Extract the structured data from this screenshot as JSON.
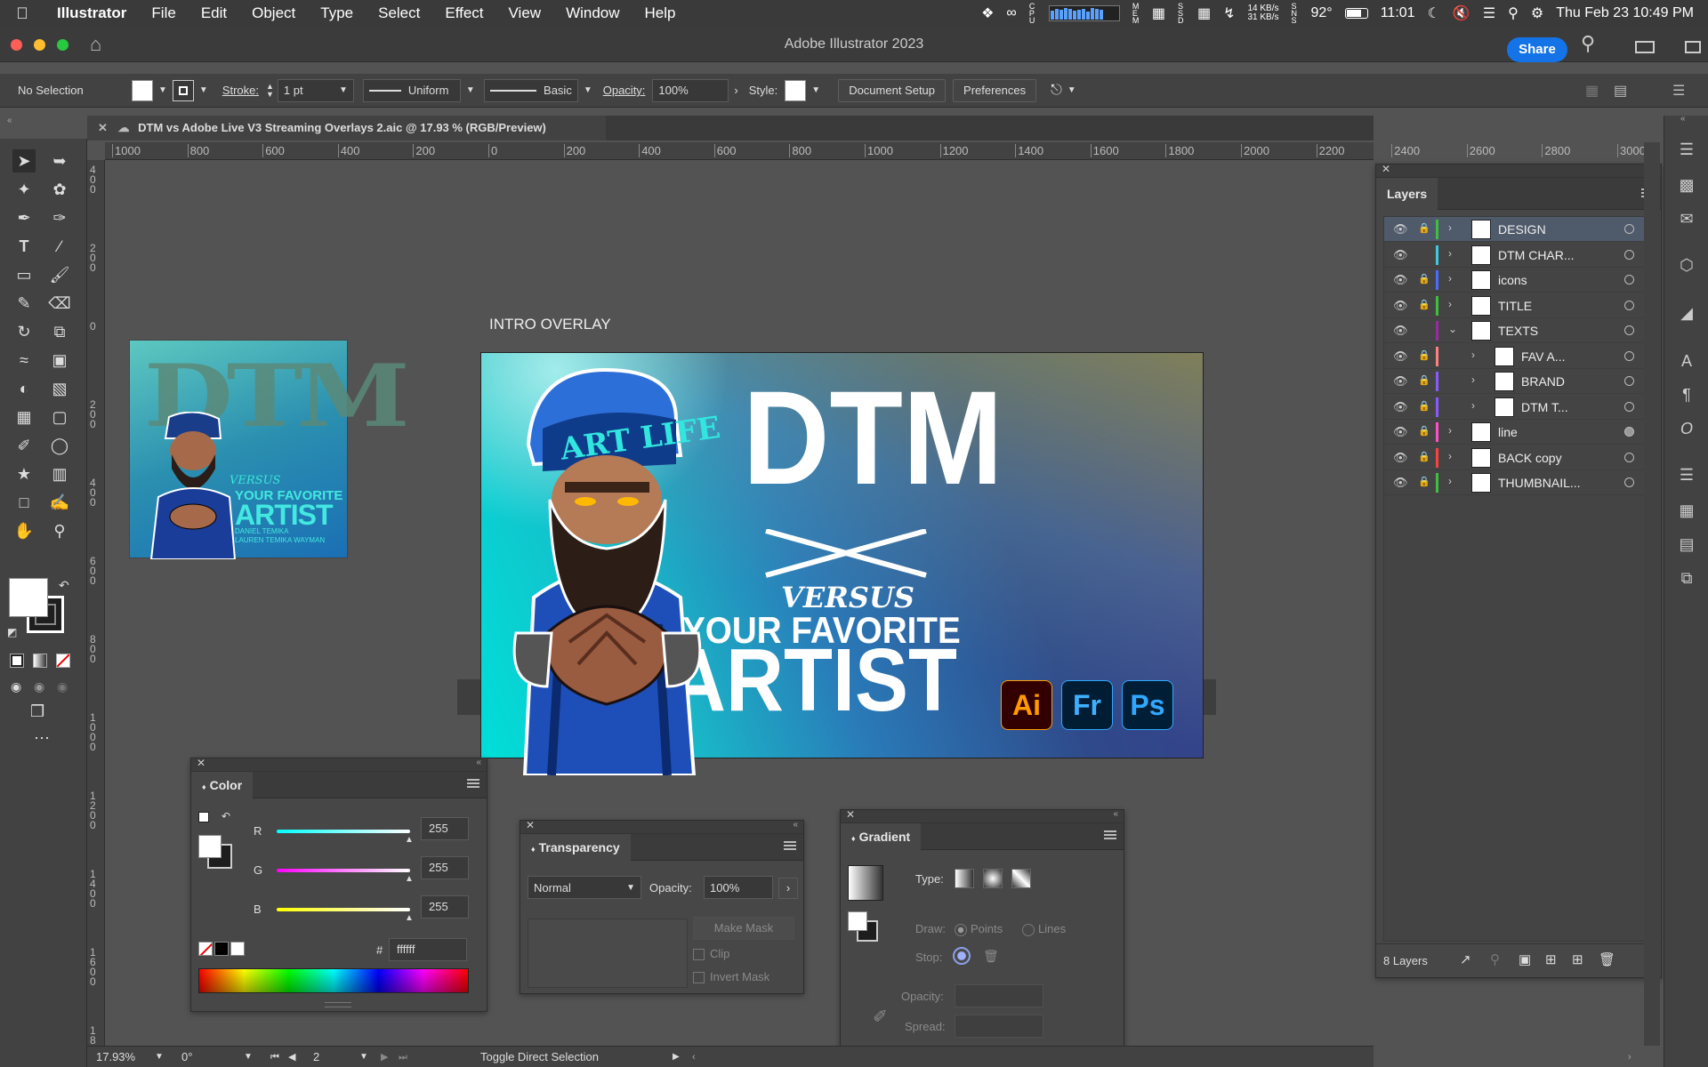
{
  "menubar": {
    "app": "Illustrator",
    "items": [
      "File",
      "Edit",
      "Object",
      "Type",
      "Select",
      "Effect",
      "View",
      "Window",
      "Help"
    ],
    "net_up": "14 KB/s",
    "net_down": "31 KB/s",
    "temp": "92°",
    "time": "11:01",
    "datetime": "Thu Feb 23  10:49 PM"
  },
  "titlebar": {
    "title": "Adobe Illustrator 2023",
    "share_label": "Share"
  },
  "control": {
    "selection": "No Selection",
    "stroke_label": "Stroke:",
    "stroke_value": "1 pt",
    "uniform_label": "Uniform",
    "basic_label": "Basic",
    "opacity_label": "Opacity:",
    "opacity_value": "100%",
    "style_label": "Style:",
    "document_setup": "Document Setup",
    "preferences": "Preferences"
  },
  "document": {
    "tab_title": "DTM vs Adobe Live V3 Streaming Overlays 2.aic @ 17.93 % (RGB/Preview)"
  },
  "ruler": {
    "h_ticks": [
      "1000",
      "800",
      "600",
      "400",
      "200",
      "0",
      "200",
      "400",
      "600",
      "800",
      "1000",
      "1200",
      "1400",
      "1600",
      "1800",
      "2000",
      "2200",
      "2400",
      "2600",
      "2800",
      "3000"
    ],
    "v_ticks": [
      "4 0 0",
      "2 0 0",
      "0",
      "2 0 0",
      "4 0 0",
      "6 0 0",
      "8 0 0",
      "1 0 0 0",
      "1 2 0 0",
      "1 4 0 0",
      "1 6 0 0",
      "1 8 0 0"
    ]
  },
  "artboard": {
    "label": "INTRO OVERLAY",
    "headline": "DTM",
    "versus": "VERSUS",
    "line1": "YOUR FAVORITE",
    "line2": "ARTIST",
    "cap_text": "ART LIFE",
    "apps": [
      "Ai",
      "Fr",
      "Ps"
    ],
    "thumb_tag": "VERSUS",
    "thumb_line1": "YOUR FAVORITE",
    "thumb_line2": "ARTIST",
    "thumb_small1": "DANIEL TEMIKA",
    "thumb_small2": "LAUREN TEMIKA WAYMAN"
  },
  "layers_panel": {
    "title": "Layers",
    "layers": [
      {
        "name": "DESIGN",
        "color": "#3fbf3f",
        "selected": true,
        "locked": true,
        "indent": 0,
        "expanded": false
      },
      {
        "name": "DTM CHAR...",
        "color": "#40c8e0",
        "selected": false,
        "locked": false,
        "indent": 0,
        "expanded": false
      },
      {
        "name": "icons",
        "color": "#4a6cff",
        "selected": false,
        "locked": true,
        "indent": 0,
        "expanded": false
      },
      {
        "name": "TITLE",
        "color": "#3fbf3f",
        "selected": false,
        "locked": true,
        "indent": 0,
        "expanded": false
      },
      {
        "name": "TEXTS",
        "color": "#9a2aa0",
        "selected": false,
        "locked": false,
        "indent": 0,
        "expanded": true
      },
      {
        "name": "FAV A...",
        "color": "#ff8080",
        "selected": false,
        "locked": true,
        "indent": 1,
        "expanded": false
      },
      {
        "name": "BRAND",
        "color": "#8a5aff",
        "selected": false,
        "locked": true,
        "indent": 1,
        "expanded": false
      },
      {
        "name": "DTM T...",
        "color": "#8a5aff",
        "selected": false,
        "locked": true,
        "indent": 1,
        "expanded": false
      },
      {
        "name": "line",
        "color": "#ff50c8",
        "selected": false,
        "locked": true,
        "indent": 0,
        "expanded": false
      },
      {
        "name": "BACK copy",
        "color": "#ff4040",
        "selected": false,
        "locked": true,
        "indent": 0,
        "expanded": false
      },
      {
        "name": "THUMBNAIL...",
        "color": "#3fbf3f",
        "selected": false,
        "locked": true,
        "indent": 0,
        "expanded": false
      }
    ],
    "count": "8 Layers"
  },
  "color_panel": {
    "title": "Color",
    "r_label": "R",
    "g_label": "G",
    "b_label": "B",
    "r": "255",
    "g": "255",
    "b": "255",
    "hash": "#",
    "hex": "ffffff"
  },
  "transparency_panel": {
    "title": "Transparency",
    "blend_mode": "Normal",
    "opacity_label": "Opacity:",
    "opacity_value": "100%",
    "make_mask": "Make Mask",
    "clip": "Clip",
    "invert_mask": "Invert Mask"
  },
  "gradient_panel": {
    "title": "Gradient",
    "type_label": "Type:",
    "draw_label": "Draw:",
    "points": "Points",
    "lines": "Lines",
    "stop_label": "Stop:",
    "opacity_label": "Opacity:",
    "spread_label": "Spread:"
  },
  "status": {
    "zoom": "17.93%",
    "rotation": "0°",
    "artboard_num": "2",
    "tool_hint": "Toggle Direct Selection"
  }
}
